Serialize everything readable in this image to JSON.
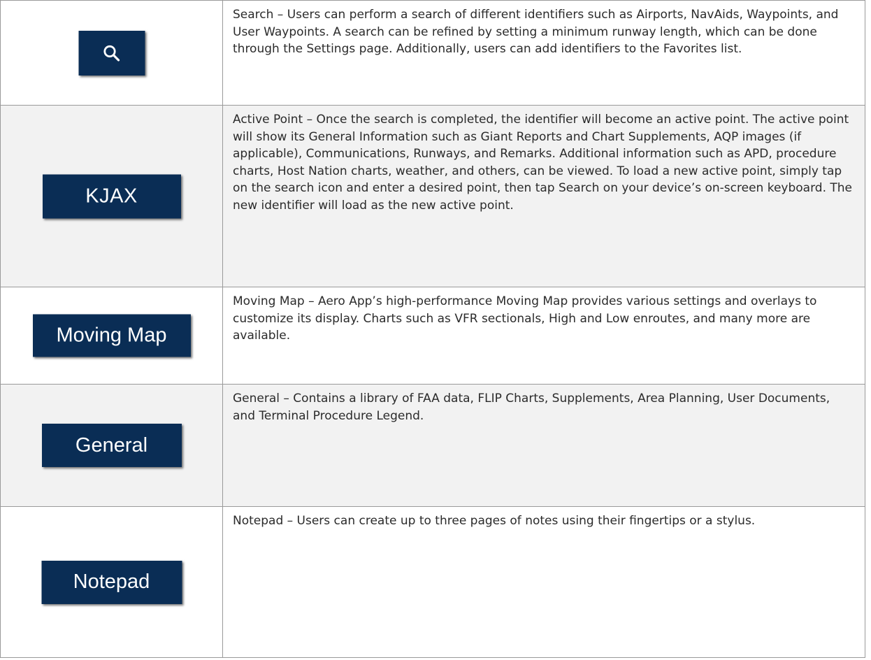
{
  "rows": [
    {
      "button_label": "",
      "icon": "search-icon",
      "description": "Search – Users can perform a search of different identifiers such as Airports, NavAids, Waypoints, and User Waypoints. A search can be refined by setting a minimum runway length, which can be done through the Settings page. Additionally, users can add identifiers to the Favorites list."
    },
    {
      "button_label": "KJAX",
      "description": "Active Point – Once the search is completed, the identifier will become an active point. The active point will show its General Information such as Giant Reports and Chart Supplements, AQP images (if applicable), Communications, Runways, and Remarks. Additional information such as APD, procedure charts, Host Nation charts, weather, and others, can be viewed. To load a new active point, simply tap on the search icon and enter a desired point, then tap Search on your device’s on-screen keyboard. The new identifier will load as the new active point."
    },
    {
      "button_label": "Moving Map",
      "description": "Moving Map – Aero App’s high-performance Moving Map provides various settings and overlays to customize its display. Charts such as VFR sectionals, High and Low enroutes, and many more are available."
    },
    {
      "button_label": "General",
      "description": "General – Contains a library of FAA data, FLIP Charts, Supplements, Area Planning, User Documents, and Terminal Procedure Legend."
    },
    {
      "button_label": "Notepad",
      "description": "Notepad – Users can create up to three pages of notes using their fingertips or a stylus."
    }
  ],
  "colors": {
    "button_bg": "#0a2d55",
    "button_text": "#ffffff",
    "shaded_row": "#f2f2f2",
    "border": "#9a9a9a"
  }
}
